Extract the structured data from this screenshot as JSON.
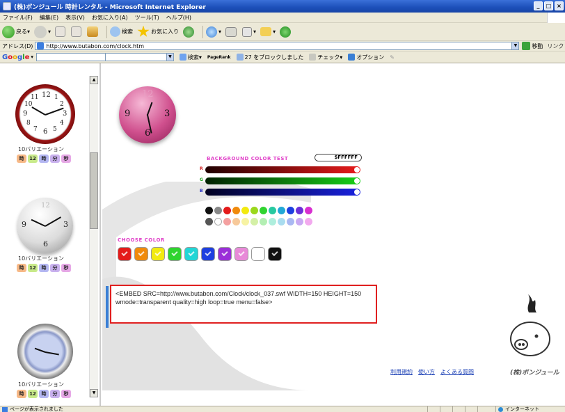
{
  "window": {
    "title": "(株)ボンジュール 時計レンタル - Microsoft Internet Explorer",
    "controls": [
      "_",
      "□",
      "×"
    ]
  },
  "menu": [
    "ファイル(F)",
    "編集(E)",
    "表示(V)",
    "お気に入り(A)",
    "ツール(T)",
    "ヘルプ(H)"
  ],
  "toolbar": {
    "back": "戻る",
    "search": "検索",
    "favorites": "お気に入り"
  },
  "address": {
    "label": "アドレス(D)",
    "url": "http://www.butabon.com/clock.htm",
    "go": "移動",
    "links": "リンク"
  },
  "google": {
    "search_btn": "検索",
    "pagerank": "PageRank",
    "blocked": "27 をブロックしました",
    "check": "チェック",
    "options": "オプション"
  },
  "sidebar": {
    "clocks": [
      {
        "variation": "10バリエーション",
        "options": [
          "時",
          "12",
          "時",
          "分",
          "秒"
        ],
        "numbers": [
          "12",
          "1",
          "2",
          "3",
          "4",
          "5",
          "6",
          "7",
          "8",
          "9",
          "10",
          "11"
        ]
      },
      {
        "variation": "10バリエーション",
        "options": [
          "時",
          "12",
          "時",
          "分",
          "秒"
        ],
        "numbers": [
          "12",
          "3",
          "6",
          "9"
        ]
      },
      {
        "variation": "10バリエーション",
        "options": [
          "時",
          "12",
          "時",
          "分",
          "秒"
        ]
      }
    ]
  },
  "preview": {
    "numbers": [
      "12",
      "3",
      "6",
      "9"
    ]
  },
  "bg_test": {
    "label": "BACKGROUND COLOR TEST",
    "hex": "$FFFFFF",
    "r": "R",
    "g": "G",
    "b": "B"
  },
  "choose": {
    "label": "CHOOSE COLOR",
    "swatch_colors": [
      "#e41b1b",
      "#f08a0c",
      "#f2ea10",
      "#2fd42f",
      "#22d6d6",
      "#1d3fe0",
      "#9b2fd8",
      "#e88ad8",
      "#ffffff",
      "#111111"
    ]
  },
  "dots": {
    "row1": [
      "#111111",
      "#888888",
      "#e41b1b",
      "#f08a0c",
      "#f2ea10",
      "#9bd81c",
      "#2fd42f",
      "#27c9a0",
      "#22a8d6",
      "#1d3fe0",
      "#6b2fd8",
      "#d82fd0"
    ],
    "row2": [
      "#555555",
      "#ffffff",
      "#f4a0a0",
      "#f7c99a",
      "#f7f3a3",
      "#d4f0a6",
      "#b3efb3",
      "#aeeedd",
      "#a9dcef",
      "#a9b8f2",
      "#c9a9f2",
      "#f2a9ee"
    ]
  },
  "embed": {
    "code": "<EMBED SRC=http://www.butabon.com/Clock/clock_037.swf WIDTH=150 HEIGHT=150 wmode=transparent quality=high loop=true menu=false>"
  },
  "footer": {
    "links": [
      "利用規約",
      "使い方",
      "よくある質問"
    ],
    "brand": "(株)ボンジュール"
  },
  "status": {
    "text": "ページが表示されました",
    "zone": "インターネット"
  }
}
